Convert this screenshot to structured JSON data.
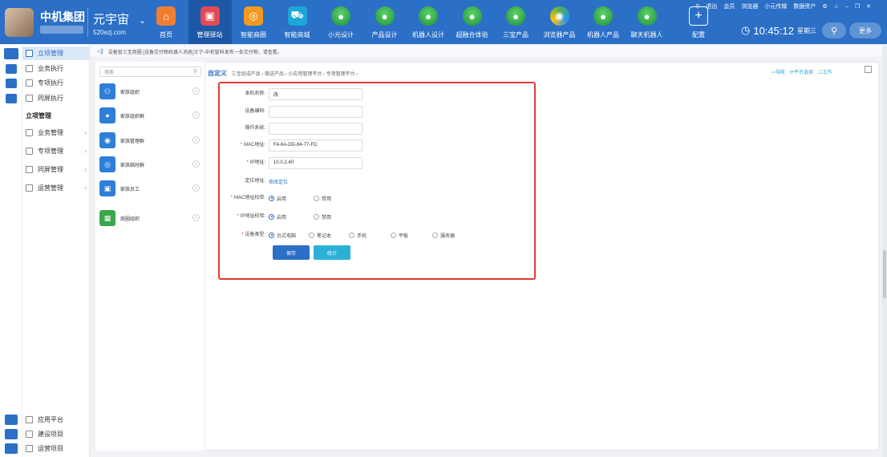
{
  "header": {
    "company": "中机集团",
    "metaverse": "元宇宙",
    "domain": "520ezj.com",
    "nav": [
      {
        "label": "首页",
        "icon": "home-icon",
        "color": "orange",
        "glyph": "⌂"
      },
      {
        "label": "管理驿站",
        "icon": "station-icon",
        "color": "red",
        "glyph": "▣",
        "active": true
      },
      {
        "label": "智能商圈",
        "icon": "circle-icon",
        "color": "amber",
        "glyph": "◎"
      },
      {
        "label": "智能商城",
        "icon": "cart-icon",
        "color": "cyan",
        "glyph": "⛟"
      },
      {
        "label": "小元设计",
        "icon": "robot-icon",
        "color": "robot",
        "glyph": "●"
      },
      {
        "label": "产品设计",
        "icon": "robot-icon",
        "color": "robot",
        "glyph": "●"
      },
      {
        "label": "机器人设计",
        "icon": "robot-icon",
        "color": "robot",
        "glyph": "●"
      },
      {
        "label": "超融合体验",
        "icon": "robot-icon",
        "color": "robot",
        "glyph": "●"
      },
      {
        "label": "三宝产品",
        "icon": "robot-icon",
        "color": "robot",
        "glyph": "●"
      },
      {
        "label": "浏览器产品",
        "icon": "browser-icon",
        "color": "swirl",
        "glyph": "◉"
      },
      {
        "label": "机器人产品",
        "icon": "robot-icon",
        "color": "robot",
        "glyph": "●"
      },
      {
        "label": "聊天机器人",
        "icon": "robot-icon",
        "color": "robot",
        "glyph": "●"
      },
      {
        "label": "配置",
        "icon": "plus-icon",
        "color": "plus",
        "glyph": "+"
      }
    ],
    "top_links": [
      "退出",
      "会员",
      "浏览器",
      "小元传媒",
      "数据资产"
    ],
    "time": "10:45:12",
    "weekday": "星期三",
    "more": "更多"
  },
  "sidebar": {
    "top_items": [
      {
        "label": "立项管理",
        "active": true
      },
      {
        "label": "业务执行"
      },
      {
        "label": "专项执行"
      },
      {
        "label": "同屏执行"
      }
    ],
    "section_title": "立项管理",
    "groups": [
      "业务管理",
      "专项管理",
      "同屏管理",
      "运营管理"
    ],
    "bottom_items": [
      "应用平台",
      "建设项目",
      "运营项目"
    ]
  },
  "notice": "设备智三宝商圈 [设备交付物机器人消息]王宁-中机智科发布一条交付物，请查看。",
  "org_panel": {
    "search_placeholder": "搜索",
    "items": [
      {
        "label": "家族组织",
        "color": "blue",
        "icon": "group-icon",
        "glyph": "⚇"
      },
      {
        "label": "家族组织群",
        "color": "blue",
        "icon": "user-icon",
        "glyph": "●"
      },
      {
        "label": "家族管理群",
        "color": "blue",
        "icon": "wifi-icon",
        "glyph": "◉"
      },
      {
        "label": "家族临时群",
        "color": "blue",
        "icon": "target-icon",
        "glyph": "◎"
      },
      {
        "label": "家族员工",
        "color": "blue",
        "icon": "badge-icon",
        "glyph": "▣"
      },
      {
        "label": "商圈组织",
        "color": "green",
        "icon": "grid-icon",
        "glyph": "▦"
      }
    ]
  },
  "breadcrumb": {
    "custom": "自定义",
    "path": "三宝组成产品 › 赠送产品 › 小应用管理平台 › 专项管理平台 ›"
  },
  "tools": [
    "⇦导航",
    "⟳平台选择",
    "☐工作"
  ],
  "form": {
    "fields": [
      {
        "label": "本机名称:",
        "value": "改",
        "required": false
      },
      {
        "label": "设备编码:",
        "value": "",
        "required": false
      },
      {
        "label": "操作系统:",
        "value": "",
        "required": false
      },
      {
        "label": "MAC地址:",
        "value": "F4-6A-DD-84-77-FD",
        "required": true
      },
      {
        "label": "IP地址:",
        "value": "10.0.2.40",
        "required": true
      }
    ],
    "location_label": "定位地址:",
    "location_link": "修改定位",
    "mac_check_label": "MAC地址校验:",
    "ip_check_label": "IP地址校验:",
    "enable": "启用",
    "disable": "禁用",
    "device_type_label": "设备类型:",
    "device_types": [
      "台式电脑",
      "笔记本",
      "手机",
      "平板",
      "服务器"
    ],
    "save": "保存",
    "stats": "统计"
  },
  "colors": {
    "primary": "#2b6fc6",
    "highlight": "#e53935",
    "cyan": "#2bb1d8"
  }
}
